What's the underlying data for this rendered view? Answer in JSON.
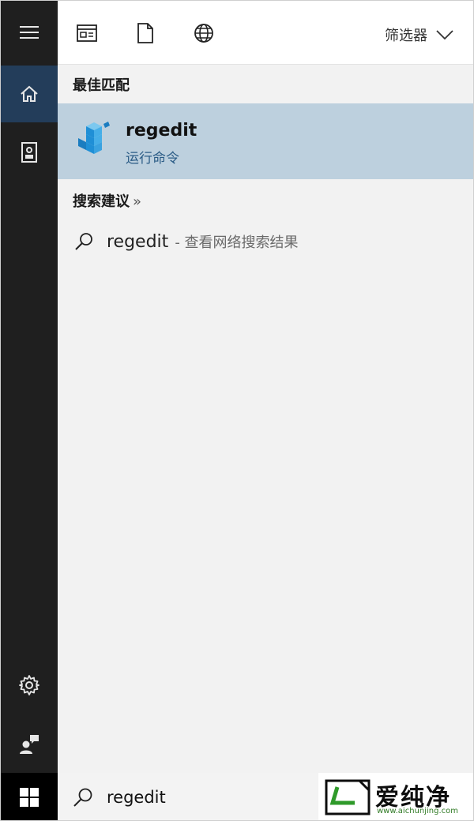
{
  "rail": {
    "icons": [
      "hamburger-icon",
      "home-icon",
      "notebook-icon",
      "gear-icon",
      "user-feedback-icon"
    ]
  },
  "toolbar": {
    "icons": [
      "apps-icon",
      "document-icon",
      "globe-icon"
    ],
    "filter_label": "筛选器"
  },
  "best_match": {
    "heading": "最佳匹配",
    "title": "regedit",
    "subtitle": "运行命令",
    "icon": "registry-editor-icon"
  },
  "suggestions": {
    "heading": "搜索建议",
    "chevron": "»",
    "items": [
      {
        "term": "regedit",
        "desc": "- 查看网络搜索结果"
      }
    ]
  },
  "taskbar": {
    "search_value": "regedit"
  },
  "watermark": {
    "brand": "爱纯净",
    "url": "www.aichunjing.com"
  },
  "colors": {
    "rail_bg": "#1f1f1f",
    "rail_active": "#233d5a",
    "highlight": "#bdd0de",
    "accent_link": "#2b5c86"
  }
}
